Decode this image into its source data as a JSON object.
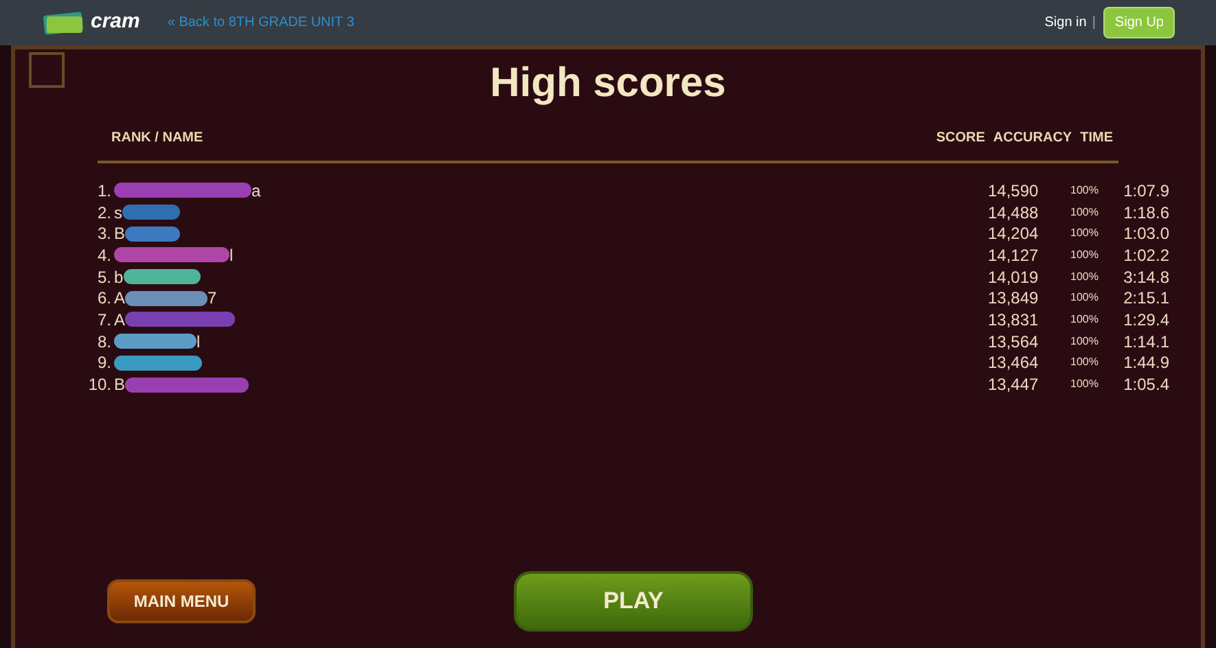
{
  "topbar": {
    "logo_text": "cram",
    "back_link": "« Back to 8TH GRADE UNIT 3",
    "sign_in": "Sign in",
    "separator": "|",
    "sign_up": "Sign Up"
  },
  "title": "High scores",
  "columns": {
    "rank_name": "RANK / NAME",
    "score": "SCORE",
    "accuracy": "ACCURACY",
    "time": "TIME"
  },
  "rows": [
    {
      "rank": "1.",
      "name_start": "",
      "name_end": "a",
      "color": "#9b3fb5",
      "score": "14,590",
      "accuracy": "100%",
      "time": "1:07.9"
    },
    {
      "rank": "2.",
      "name_start": "s",
      "name_end": "",
      "color": "#2f6fb0",
      "score": "14,488",
      "accuracy": "100%",
      "time": "1:18.6"
    },
    {
      "rank": "3.",
      "name_start": "B",
      "name_end": "",
      "color": "#3d7ac0",
      "score": "14,204",
      "accuracy": "100%",
      "time": "1:03.0"
    },
    {
      "rank": "4.",
      "name_start": "",
      "name_end": "l",
      "color": "#b045a8",
      "score": "14,127",
      "accuracy": "100%",
      "time": "1:02.2"
    },
    {
      "rank": "5.",
      "name_start": "b",
      "name_end": "",
      "color": "#4fb59a",
      "score": "14,019",
      "accuracy": "100%",
      "time": "3:14.8"
    },
    {
      "rank": "6.",
      "name_start": "A",
      "name_end": "7",
      "color": "#6a8fb8",
      "score": "13,849",
      "accuracy": "100%",
      "time": "2:15.1"
    },
    {
      "rank": "7.",
      "name_start": "A",
      "name_end": "",
      "color": "#7a3fb0",
      "score": "13,831",
      "accuracy": "100%",
      "time": "1:29.4"
    },
    {
      "rank": "8.",
      "name_start": "",
      "name_end": "l",
      "color": "#5a9ec8",
      "score": "13,564",
      "accuracy": "100%",
      "time": "1:14.1"
    },
    {
      "rank": "9.",
      "name_start": "",
      "name_end": "",
      "color": "#3a9ac0",
      "score": "13,464",
      "accuracy": "100%",
      "time": "1:44.9"
    },
    {
      "rank": "10.",
      "name_start": "B",
      "name_end": "",
      "color": "#9a3fb0",
      "score": "13,447",
      "accuracy": "100%",
      "time": "1:05.4"
    }
  ],
  "buttons": {
    "main_menu": "MAIN MENU",
    "play": "PLAY"
  }
}
